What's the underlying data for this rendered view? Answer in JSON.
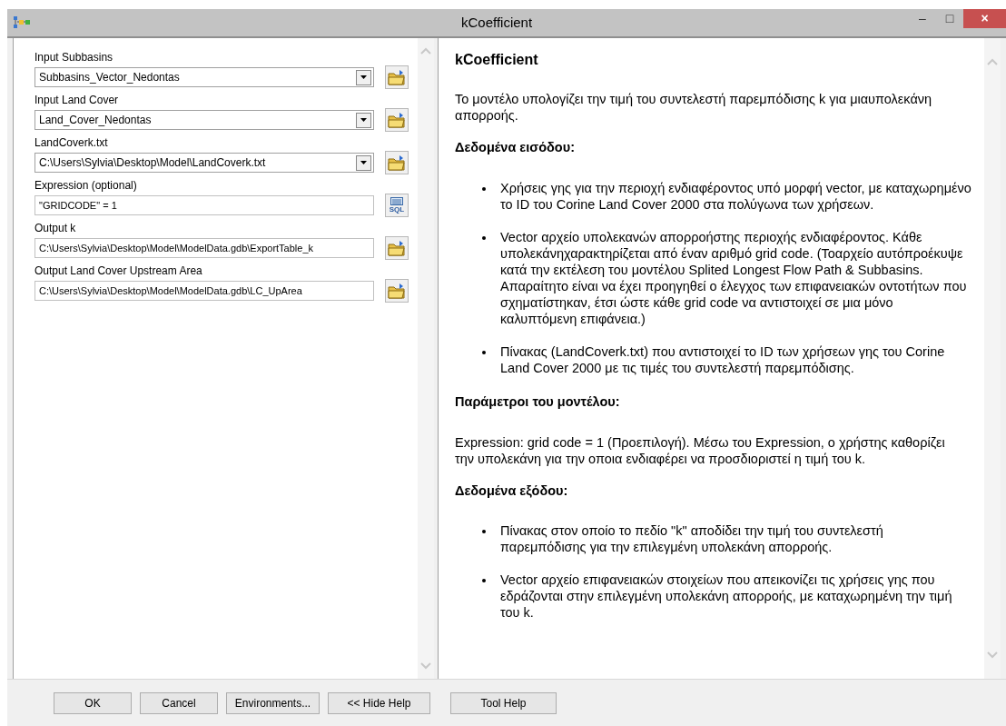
{
  "window": {
    "title": "kCoefficient",
    "controls": [
      "–",
      "□",
      "×"
    ]
  },
  "parameters": [
    {
      "label": "Input Subbasins",
      "kind": "dropdown",
      "value": "Subbasins_Vector_Nedontas",
      "button": {
        "kind": "folder"
      }
    },
    {
      "label": "Input Land Cover",
      "kind": "dropdown",
      "value": "Land_Cover_Nedontas",
      "button": {
        "kind": "folder"
      }
    },
    {
      "label": "LandCoverk.txt",
      "kind": "dropdown",
      "value": "C:\\Users\\Sylvia\\Desktop\\Model\\LandCoverk.txt",
      "button": {
        "kind": "folder"
      }
    },
    {
      "label": "Expression (optional)",
      "kind": "text",
      "value": "\"GRIDCODE\" = 1",
      "button": {
        "kind": "sql",
        "label": "SQL"
      }
    },
    {
      "label": "Output k",
      "kind": "text",
      "value": "C:\\Users\\Sylvia\\Desktop\\Model\\ModelData.gdb\\ExportTable_k",
      "button": {
        "kind": "folder"
      }
    },
    {
      "label": "Output Land Cover Upstream Area",
      "kind": "text",
      "value": "C:\\Users\\Sylvia\\Desktop\\Model\\ModelData.gdb\\LC_UpArea",
      "button": {
        "kind": "folder"
      }
    }
  ],
  "help": [
    {
      "kind": "title",
      "text": "kCoefficient"
    },
    {
      "kind": "paragraph",
      "text": "Το μοντέλο υπολογίζει την τιμή του συντελεστή παρεμπόδισης k για μιαυπολεκάνη απορροής."
    },
    {
      "kind": "heading",
      "text": "Δεδομένα εισόδου:"
    },
    {
      "kind": "bullet",
      "text": "Χρήσεις γης για την περιοχή ενδιαφέροντος υπό μορφή vector, με καταχωρημένο το ID του Corine Land Cover 2000 στα πολύγωνα των χρήσεων."
    },
    {
      "kind": "bullet",
      "text": "Vector αρχείο υπολεκανών απορροήστης περιοχής ενδιαφέροντος. Κάθε υπολεκάνηχαρακτηρίζεται από έναν αριθμό grid code. (Τοαρχείο αυτόπροέκυψε κατά την εκτέλεση του μοντέλου Splited Longest Flow Path & Subbasins. Απαραίτητο είναι να έχει προηγηθεί ο έλεγχος των επιφανειακών οντοτήτων που σχηματίστηκαν, έτσι ώστε κάθε grid code να αντιστοιχεί σε μια μόνο καλυπτόμενη επιφάνεια.)"
    },
    {
      "kind": "bullet",
      "text": "Πίνακας (LandCoverk.txt) που αντιστοιχεί το ID των χρήσεων γης του Corine Land Cover 2000 με τις τιμές του συντελεστή παρεμπόδισης."
    },
    {
      "kind": "heading",
      "text": "Παράμετροι του μοντέλου:"
    },
    {
      "kind": "paragraph",
      "text": "Expression: grid code = 1 (Προεπιλογή). Μέσω του Expression, ο χρήστης καθορίζει την υπολεκάνη για την οποια ενδιαφέρει να προσδιοριστεί η τιμή του k."
    },
    {
      "kind": "heading",
      "text": "Δεδομένα εξόδου:"
    },
    {
      "kind": "bullet",
      "text": "Πίνακας στον οποίο το πεδίο \"k\" αποδίδει την τιμή του συντελεστή παρεμπόδισης για την επιλεγμένη υπολεκάνη απορροής."
    },
    {
      "kind": "bullet",
      "text": "Vector αρχείο επιφανειακών στοιχείων που απεικονίζει τις χρήσεις γης που εδράζονται στην επιλεγμένη υπολεκάνη απορροής, με καταχωρημένη την τιμή του k."
    }
  ],
  "buttons": [
    "OK",
    "Cancel",
    "Environments...",
    "<< Hide Help",
    "Tool Help"
  ]
}
